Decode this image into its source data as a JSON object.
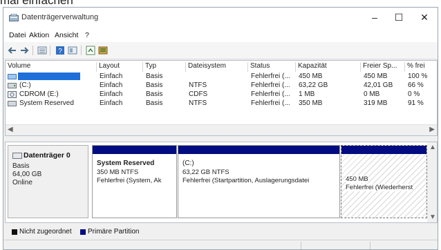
{
  "page_top_text": "mal einfachen",
  "window": {
    "title": "Datenträgerverwaltung",
    "controls": {
      "minimize": "–",
      "maximize": "☐",
      "close": "✕"
    }
  },
  "menu": [
    "Datei",
    "Aktion",
    "Ansicht",
    "?"
  ],
  "toolbar_icons": [
    "back-arrow-icon",
    "forward-arrow-icon",
    "list-view-icon",
    "help-icon",
    "properties-icon",
    "refresh-icon",
    "settings-icon"
  ],
  "volume_table": {
    "headers": [
      "Volume",
      "Layout",
      "Typ",
      "Dateisystem",
      "Status",
      "Kapazität",
      "Freier Sp...",
      "% frei"
    ],
    "rows": [
      {
        "volume": "",
        "layout": "Einfach",
        "typ": "Basis",
        "fs": "",
        "status": "Fehlerfrei (...",
        "kap": "450 MB",
        "frei": "450 MB",
        "pct": "100 %"
      },
      {
        "volume": "(C:)",
        "layout": "Einfach",
        "typ": "Basis",
        "fs": "NTFS",
        "status": "Fehlerfrei (...",
        "kap": "63,22 GB",
        "frei": "42,01 GB",
        "pct": "66 %"
      },
      {
        "volume": "CDROM (E:)",
        "layout": "Einfach",
        "typ": "Basis",
        "fs": "CDFS",
        "status": "Fehlerfrei (...",
        "kap": "1 MB",
        "frei": "0 MB",
        "pct": "0 %"
      },
      {
        "volume": "System Reserved",
        "layout": "Einfach",
        "typ": "Basis",
        "fs": "NTFS",
        "status": "Fehlerfrei (...",
        "kap": "350 MB",
        "frei": "319 MB",
        "pct": "91 %"
      }
    ]
  },
  "disk": {
    "name": "Datenträger 0",
    "type": "Basis",
    "size": "64,00 GB",
    "state": "Online",
    "partitions": [
      {
        "name": "System Reserved",
        "size_fs": "350 MB NTFS",
        "status": "Fehlerfrei (System, Ak"
      },
      {
        "name": "(C:)",
        "size_fs": "63,22 GB NTFS",
        "status": "Fehlerfrei (Startpartition, Auslagerungsdatei"
      },
      {
        "name": "",
        "size_fs": "450 MB",
        "status": "Fehlerfrei (Wiederherst"
      }
    ]
  },
  "legend": [
    {
      "label": "Nicht zugeordnet",
      "color": "#111111"
    },
    {
      "label": "Primäre Partition",
      "color": "#000c80"
    }
  ],
  "colors": {
    "accent_partition": "#000c80",
    "selection": "#1e6fd9"
  }
}
